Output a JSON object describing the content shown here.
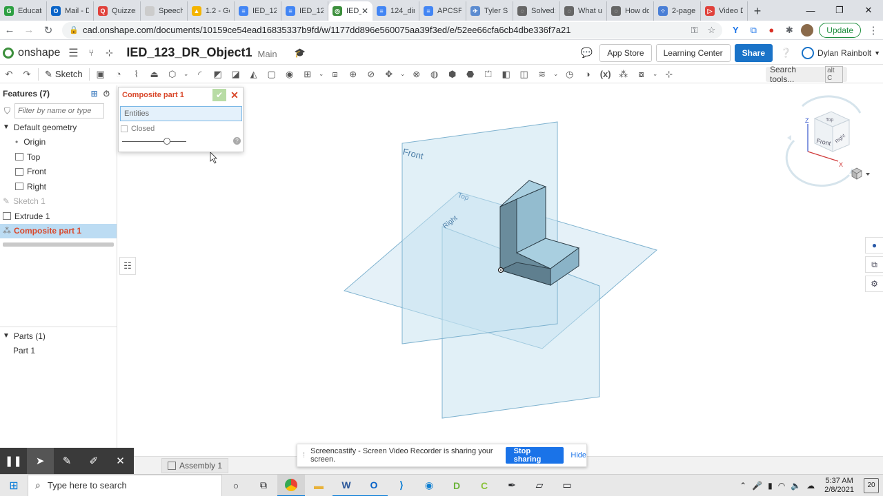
{
  "browser": {
    "tabs": [
      {
        "label": "Educato",
        "color": "#2ea043",
        "glyph": "G"
      },
      {
        "label": "Mail - D",
        "color": "#0a64c8",
        "glyph": "O"
      },
      {
        "label": "Quizzes",
        "color": "#e0413b",
        "glyph": "Q"
      },
      {
        "label": "Speechi",
        "color": "#cccccc",
        "glyph": ""
      },
      {
        "label": "1.2 - Go",
        "color": "#f4b400",
        "glyph": "▲"
      },
      {
        "label": "IED_122",
        "color": "#4285f4",
        "glyph": "≡"
      },
      {
        "label": "IED_123",
        "color": "#4285f4",
        "glyph": "≡"
      },
      {
        "label": "IED_",
        "color": "#3c8f3c",
        "glyph": "◎",
        "active": true
      },
      {
        "label": "124_din",
        "color": "#4285f4",
        "glyph": "≡"
      },
      {
        "label": "APCSP_",
        "color": "#4285f4",
        "glyph": "≡"
      },
      {
        "label": "Tyler Sh",
        "color": "#5b8bd0",
        "glyph": "✈"
      },
      {
        "label": "Solved:",
        "color": "#666666",
        "glyph": "◌"
      },
      {
        "label": "What us",
        "color": "#666666",
        "glyph": "◌"
      },
      {
        "label": "How do",
        "color": "#666666",
        "glyph": "◌"
      },
      {
        "label": "2-page",
        "color": "#4a7fd6",
        "glyph": "⁘"
      },
      {
        "label": "Video D",
        "color": "#e0413b",
        "glyph": "▷"
      }
    ],
    "new_tab_glyph": "+",
    "url": "cad.onshape.com/documents/10159ce54ead16835337b9fd/w/1177dd896e560075aa39f3ed/e/52ee66cfa6cb4dbe336f7a21",
    "update_label": "Update"
  },
  "onshape": {
    "brand": "onshape",
    "doc_name": "IED_123_DR_Object1",
    "branch": "Main",
    "app_store": "App Store",
    "learning_center": "Learning Center",
    "share": "Share",
    "user": "Dylan Rainbolt",
    "sketch_label": "Sketch",
    "search_tools": "Search tools...",
    "search_shortcut": "alt C"
  },
  "features": {
    "header": "Features (7)",
    "filter_placeholder": "Filter by name or type",
    "items": [
      {
        "label": "Default geometry",
        "type": "group"
      },
      {
        "label": "Origin",
        "type": "origin"
      },
      {
        "label": "Top",
        "type": "plane"
      },
      {
        "label": "Front",
        "type": "plane"
      },
      {
        "label": "Right",
        "type": "plane"
      },
      {
        "label": "Sketch 1",
        "type": "sketch"
      },
      {
        "label": "Extrude 1",
        "type": "extrude"
      },
      {
        "label": "Composite part 1",
        "type": "composite"
      }
    ],
    "parts_header": "Parts (1)",
    "parts": [
      "Part 1"
    ]
  },
  "dialog": {
    "title": "Composite part 1",
    "entities_placeholder": "Entities",
    "closed_label": "Closed",
    "slider_value": 0.7
  },
  "viewport": {
    "plane_labels": {
      "front": "Front",
      "top": "Top",
      "right": "Right"
    },
    "viewcube": {
      "top": "Top",
      "front": "Front",
      "right": "Right",
      "z": "Z",
      "x": "X"
    }
  },
  "bottom": {
    "assembly_tab": "Assembly 1",
    "screencastify_msg": "Screencastify - Screen Video Recorder is sharing your screen.",
    "stop_sharing": "Stop sharing",
    "hide": "Hide"
  },
  "taskbar": {
    "search_placeholder": "Type here to search",
    "time": "5:37 AM",
    "date": "2/8/2021",
    "notifications": "20"
  },
  "colors": {
    "accent": "#1a73c8",
    "selected_feature": "#d9482b",
    "plane_fill": "#bfe0ef",
    "plane_stroke": "#6fa8c8",
    "part_face": "#8fb7cc",
    "part_side": "#5f7f8f"
  }
}
